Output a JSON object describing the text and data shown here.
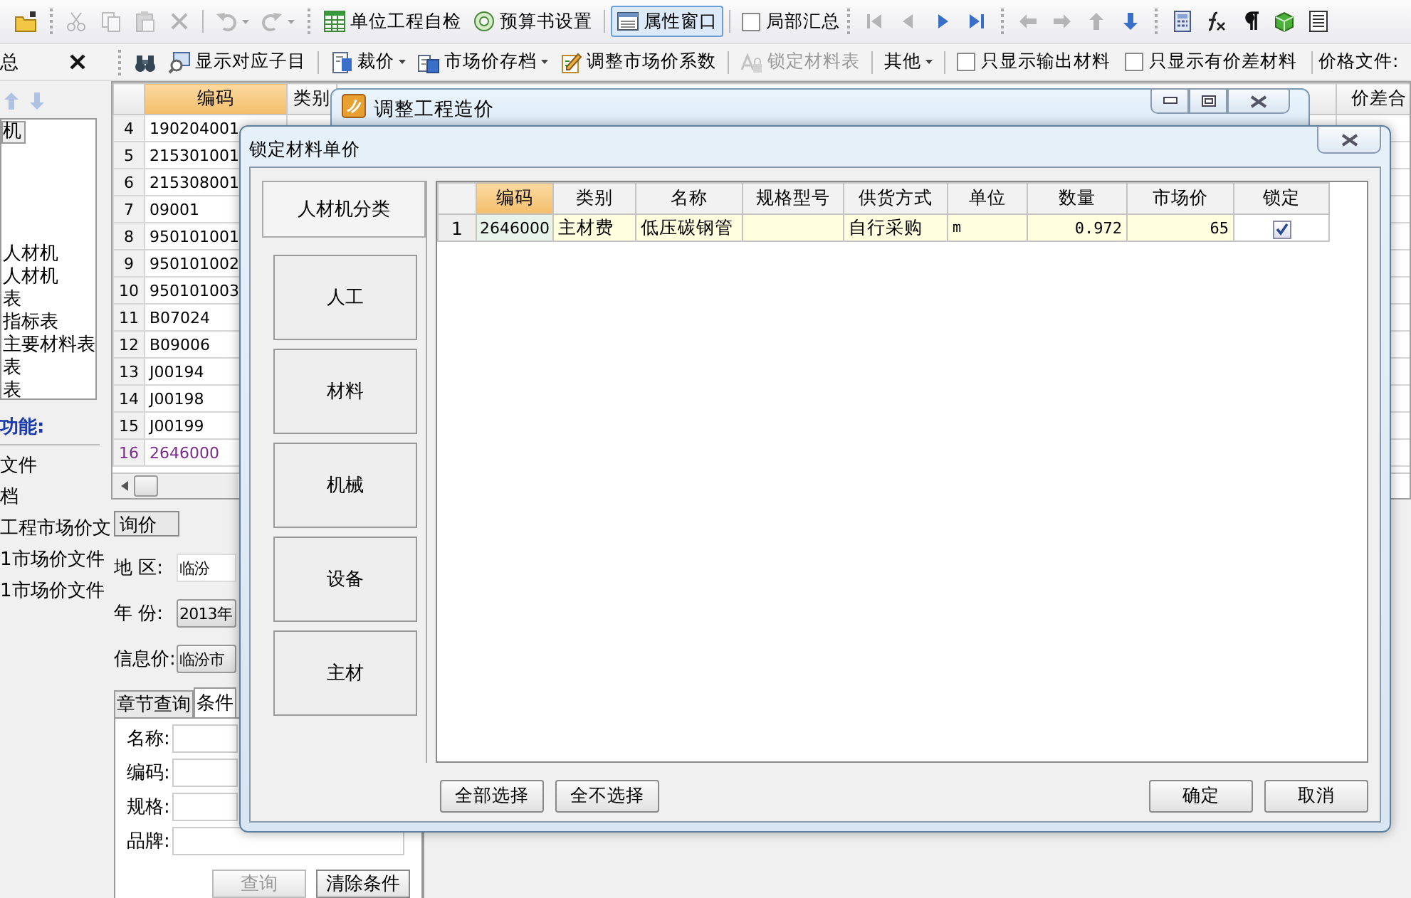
{
  "toolbar_top": {
    "tools": [
      {
        "disabled": false
      },
      {
        "disabled": true
      },
      {
        "disabled": true
      },
      {
        "disabled": true
      },
      {
        "disabled": true
      },
      {
        "disabled": true
      },
      {
        "disabled": true
      }
    ],
    "buttons": [
      {
        "label": "单位工程自检",
        "selected": false
      },
      {
        "label": "预算书设置",
        "selected": false
      },
      {
        "label": "属性窗口",
        "selected": true
      }
    ],
    "checkbox": {
      "label": "局部汇总",
      "checked": false
    },
    "record_nav": [
      {
        "disabled": true
      },
      {
        "disabled": true
      },
      {
        "disabled": false
      },
      {
        "disabled": false
      }
    ],
    "move": [
      {
        "disabled": true
      },
      {
        "disabled": true
      },
      {
        "disabled": true
      },
      {
        "disabled": false
      }
    ]
  },
  "toolbar_second": {
    "panel_title": "总",
    "buttons": [
      {
        "label": "显示对应子目",
        "disabled": false,
        "dropdown": false
      },
      {
        "label": "裁价",
        "disabled": false,
        "dropdown": true
      },
      {
        "label": "市场价存档",
        "disabled": false,
        "dropdown": true
      },
      {
        "label": "调整市场价系数",
        "disabled": false,
        "dropdown": false
      },
      {
        "label": "锁定材料表",
        "disabled": true,
        "dropdown": false
      },
      {
        "label": "其他",
        "disabled": false,
        "dropdown": true
      }
    ],
    "checkboxes": [
      {
        "label": "只显示输出材料",
        "checked": false
      },
      {
        "label": "只显示有价差材料",
        "checked": false
      }
    ],
    "price_file_label": "价格文件:"
  },
  "left_panel": {
    "tree": [
      {
        "label": "机",
        "selected": true
      },
      {
        "label": "人材机",
        "selected": false
      },
      {
        "label": "人材机",
        "selected": false
      },
      {
        "label": "表",
        "selected": false
      },
      {
        "label": "指标表",
        "selected": false
      },
      {
        "label": "主要材料表",
        "selected": false
      },
      {
        "label": "表",
        "selected": false
      },
      {
        "label": "表",
        "selected": false
      }
    ],
    "functions_title": "功能:",
    "functions": [
      "文件",
      "档",
      "工程市场价文",
      "1市场价文件",
      "1市场价文件"
    ]
  },
  "grid": {
    "columns": [
      {
        "label": "编码",
        "selected": true
      },
      {
        "label": "类别",
        "selected": false
      },
      {
        "label": "价差合",
        "selected": false
      }
    ],
    "rows": [
      {
        "num": "4",
        "code": "190204001",
        "selected": false
      },
      {
        "num": "5",
        "code": "215301001",
        "selected": false
      },
      {
        "num": "6",
        "code": "215308001",
        "selected": false
      },
      {
        "num": "7",
        "code": "09001",
        "selected": false
      },
      {
        "num": "8",
        "code": "950101001",
        "selected": false
      },
      {
        "num": "9",
        "code": "950101002",
        "selected": false
      },
      {
        "num": "10",
        "code": "950101003",
        "selected": false
      },
      {
        "num": "11",
        "code": "B07024",
        "selected": false
      },
      {
        "num": "12",
        "code": "B09006",
        "selected": false
      },
      {
        "num": "13",
        "code": "J00194",
        "selected": false
      },
      {
        "num": "14",
        "code": "J00198",
        "selected": false
      },
      {
        "num": "15",
        "code": "J00199",
        "selected": false
      },
      {
        "num": "16",
        "code": "2646000",
        "selected": true
      }
    ]
  },
  "query_panel": {
    "tab": "询价",
    "region": {
      "label": "地 区:",
      "value": "临汾"
    },
    "year": {
      "label": "年 份:",
      "value": "2013年"
    },
    "info_price": {
      "label": "信息价:",
      "value": "临汾市"
    },
    "tabs": [
      {
        "label": "章节查询",
        "selected": false
      },
      {
        "label": "条件",
        "selected": true
      }
    ],
    "fields": [
      {
        "label": "名称:"
      },
      {
        "label": "编码:"
      },
      {
        "label": "规格:"
      },
      {
        "label": "品牌:"
      }
    ],
    "buttons": [
      {
        "label": "查询",
        "disabled": true
      },
      {
        "label": "清除条件",
        "disabled": false
      }
    ]
  },
  "back_window": {
    "title": "调整工程造价"
  },
  "dialog": {
    "title": "锁定材料单价",
    "category_header": "人材机分类",
    "categories": [
      "人工",
      "材料",
      "机械",
      "设备",
      "主材"
    ],
    "columns": [
      {
        "label": "编码",
        "selected": true
      },
      {
        "label": "类别",
        "selected": false
      },
      {
        "label": "名称",
        "selected": false
      },
      {
        "label": "规格型号",
        "selected": false
      },
      {
        "label": "供货方式",
        "selected": false
      },
      {
        "label": "单位",
        "selected": false
      },
      {
        "label": "数量",
        "selected": false
      },
      {
        "label": "市场价",
        "selected": false
      },
      {
        "label": "锁定",
        "selected": false
      }
    ],
    "rows": [
      {
        "num": "1",
        "code": "2646000",
        "type": "主材费",
        "name": "低压碳钢管",
        "supply": "自行采购",
        "unit": "m",
        "quantity": "0.972",
        "price": "65",
        "locked": true
      }
    ],
    "buttons_left": [
      "全部选择",
      "全不选择"
    ],
    "buttons_right": [
      "确定",
      "取消"
    ]
  }
}
